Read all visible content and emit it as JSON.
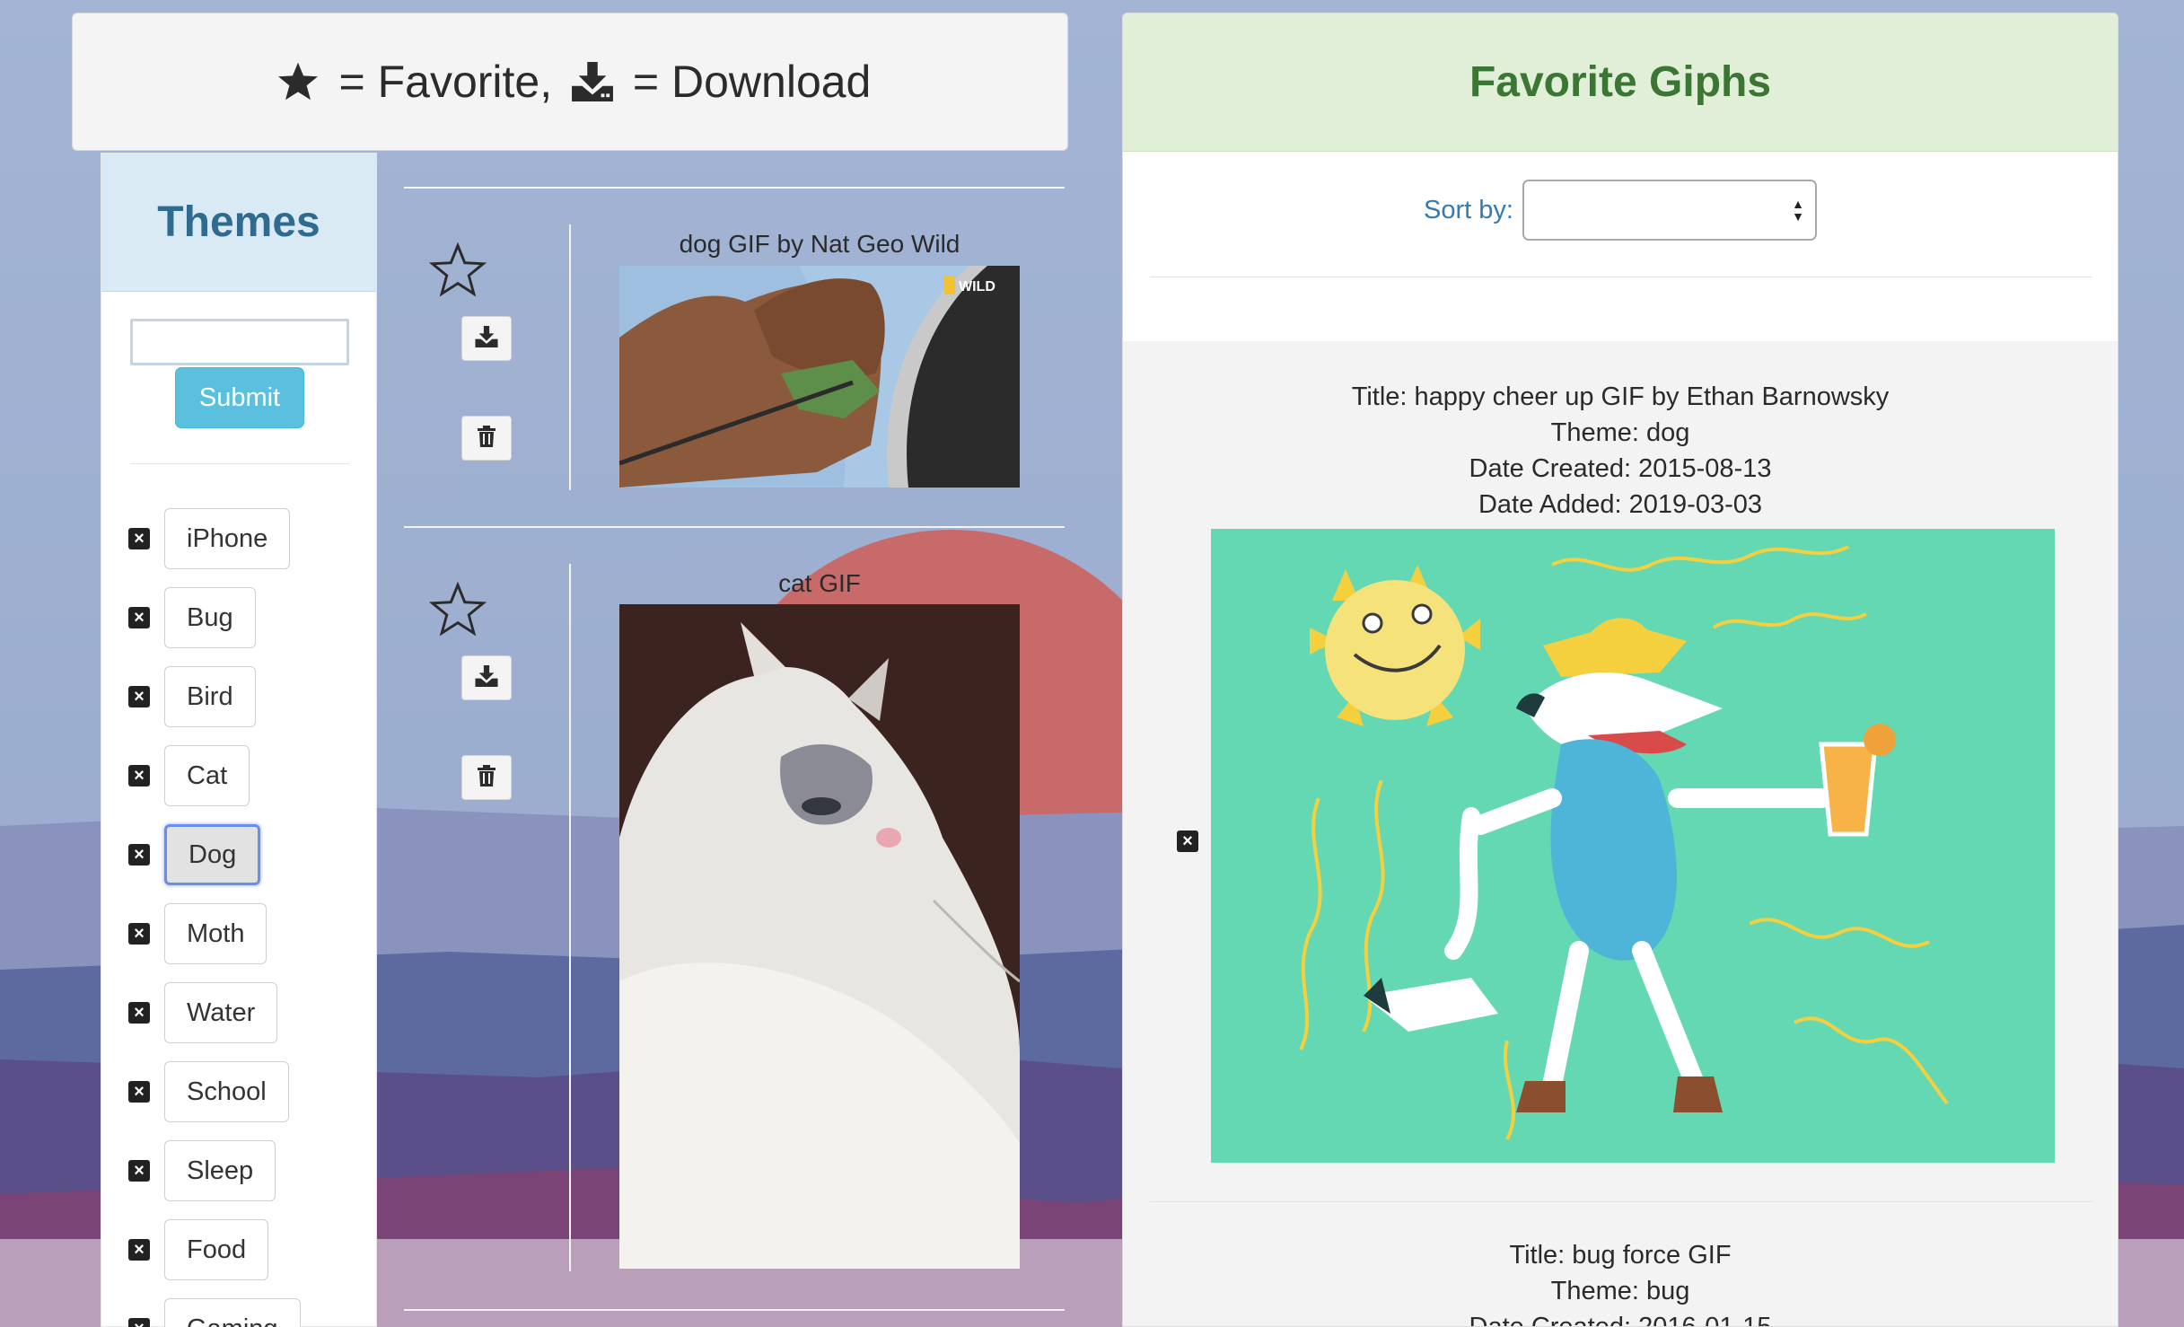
{
  "legend": {
    "favorite_text": " = Favorite, ",
    "download_text": " = Download",
    "favorite_icon": "star-filled-icon",
    "download_icon": "download-icon"
  },
  "themes": {
    "title": "Themes",
    "input_value": "",
    "submit_label": "Submit",
    "items": [
      {
        "label": "iPhone",
        "active": false
      },
      {
        "label": "Bug",
        "active": false
      },
      {
        "label": "Bird",
        "active": false
      },
      {
        "label": "Cat",
        "active": false
      },
      {
        "label": "Dog",
        "active": true
      },
      {
        "label": "Moth",
        "active": false
      },
      {
        "label": "Water",
        "active": false
      },
      {
        "label": "School",
        "active": false
      },
      {
        "label": "Sleep",
        "active": false
      },
      {
        "label": "Food",
        "active": false
      },
      {
        "label": "Gaming",
        "active": false
      }
    ],
    "remove_icon": "close-square-icon"
  },
  "results": [
    {
      "title": "dog GIF by Nat Geo Wild",
      "favorited": false
    },
    {
      "title": "cat GIF",
      "favorited": false
    }
  ],
  "favorites": {
    "title": "Favorite Giphs",
    "sort_label": "Sort by:",
    "sort_value": "",
    "items": [
      {
        "title": "Title: happy cheer up GIF by Ethan Barnowsky",
        "theme": "Theme: dog",
        "created": "Date Created: 2015-08-13",
        "added": "Date Added: 2019-03-03"
      },
      {
        "title": "Title: bug force GIF",
        "theme": "Theme: bug",
        "created": "Date Created: 2016-01-15"
      }
    ]
  },
  "colors": {
    "themes_header_bg": "#d9eaf5",
    "themes_header_text": "#2f6a8f",
    "fav_header_bg": "#e1efd8",
    "fav_header_text": "#3c7634",
    "submit_bg": "#5bc0de",
    "link_blue": "#337ab7"
  }
}
